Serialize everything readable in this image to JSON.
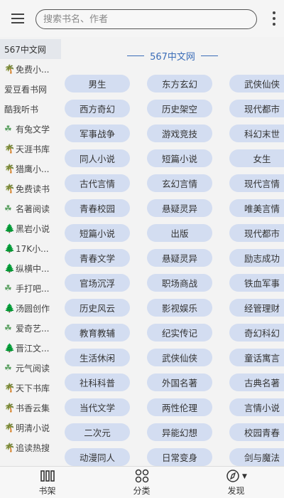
{
  "header": {
    "menu_icon": "menu-icon",
    "search_placeholder": "搜索书名、作者",
    "more_icon": "more-vertical-icon"
  },
  "sidebar": {
    "items": [
      {
        "label": "567中文网",
        "icon": "",
        "active": true
      },
      {
        "label": "免费小...",
        "icon": "palm"
      },
      {
        "label": "爱豆看书网",
        "icon": ""
      },
      {
        "label": "酷我听书",
        "icon": ""
      },
      {
        "label": "有兔文学",
        "icon": "clover"
      },
      {
        "label": "天涯书库",
        "icon": "palm"
      },
      {
        "label": "猎鹰小...",
        "icon": "palm"
      },
      {
        "label": "免费读书",
        "icon": "palm"
      },
      {
        "label": "名著阅读",
        "icon": "clover"
      },
      {
        "label": "黑岩小说",
        "icon": "tree"
      },
      {
        "label": "17K小...",
        "icon": "tree"
      },
      {
        "label": "纵横中...",
        "icon": "tree"
      },
      {
        "label": "手打吧...",
        "icon": "clover"
      },
      {
        "label": "汤圆创作",
        "icon": "tree"
      },
      {
        "label": "爱奇艺...",
        "icon": "clover"
      },
      {
        "label": "晋江文...",
        "icon": "tree"
      },
      {
        "label": "元气阅读",
        "icon": "clover"
      },
      {
        "label": "天下书库",
        "icon": "palm"
      },
      {
        "label": "书香云集",
        "icon": "palm"
      },
      {
        "label": "明清小说",
        "icon": "palm"
      },
      {
        "label": "追读热搜",
        "icon": "palm"
      }
    ]
  },
  "main": {
    "section_title": "567中文网",
    "categories": [
      "男生",
      "东方玄幻",
      "武侠仙侠",
      "西方奇幻",
      "历史架空",
      "现代都市",
      "军事战争",
      "游戏竞技",
      "科幻末世",
      "同人小说",
      "短篇小说",
      "女生",
      "古代言情",
      "玄幻言情",
      "现代言情",
      "青春校园",
      "悬疑灵异",
      "唯美言情",
      "短篇小说",
      "出版",
      "现代都市",
      "青春文学",
      "悬疑灵异",
      "励志成功",
      "官场沉浮",
      "职场商战",
      "铁血军事",
      "历史风云",
      "影视娱乐",
      "经管理财",
      "教育教辅",
      "纪实传记",
      "奇幻科幻",
      "生活休闲",
      "武侠仙侠",
      "童话寓言",
      "社科科普",
      "外国名著",
      "古典名著",
      "当代文学",
      "两性伦理",
      "言情小说",
      "二次元",
      "异能幻想",
      "校园青春",
      "动漫同人",
      "日常变身",
      "剑与魔法"
    ]
  },
  "bottom_nav": {
    "tabs": [
      {
        "label": "书架",
        "icon": "bookshelf-icon"
      },
      {
        "label": "分类",
        "icon": "category-icon"
      },
      {
        "label": "发现",
        "icon": "compass-icon"
      }
    ]
  }
}
